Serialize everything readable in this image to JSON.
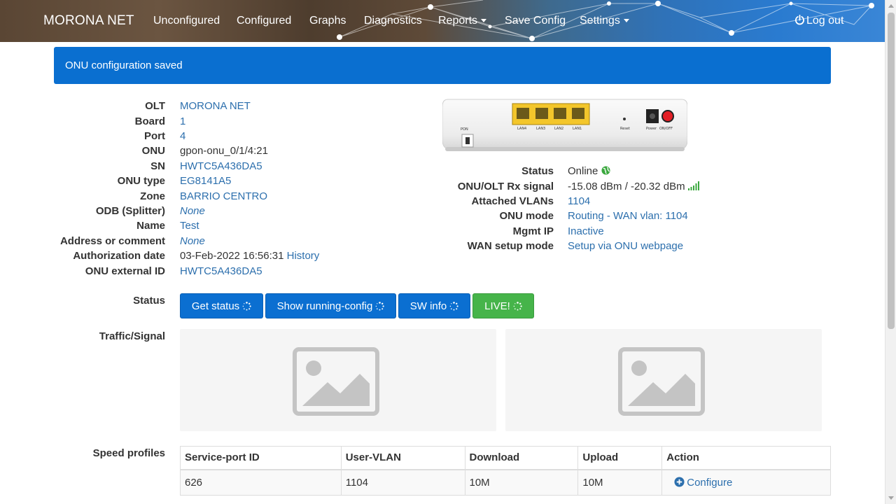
{
  "navbar": {
    "brand": "MORONA NET",
    "items": [
      {
        "label": "Unconfigured"
      },
      {
        "label": "Configured"
      },
      {
        "label": "Graphs"
      },
      {
        "label": "Diagnostics"
      },
      {
        "label": "Reports"
      },
      {
        "label": "Save Config"
      },
      {
        "label": "Settings"
      }
    ],
    "logout": "Log out"
  },
  "alert": {
    "message": "ONU configuration saved"
  },
  "details_left": [
    {
      "label": "OLT",
      "value": "MORONA NET"
    },
    {
      "label": "Board",
      "value": "1"
    },
    {
      "label": "Port",
      "value": "4"
    },
    {
      "label": "ONU",
      "value": "gpon-onu_0/1/4:21"
    },
    {
      "label": "SN",
      "value": "HWTC5A436DA5"
    },
    {
      "label": "ONU type",
      "value": "EG8141A5"
    },
    {
      "label": "Zone",
      "value": "BARRIO CENTRO"
    },
    {
      "label": "ODB (Splitter)",
      "value": "None"
    },
    {
      "label": "Name",
      "value": "Test"
    },
    {
      "label": "Address or comment",
      "value": "None"
    },
    {
      "label": "Authorization date",
      "value": "03-Feb-2022 16:56:31",
      "link": "History"
    },
    {
      "label": "ONU external ID",
      "value": "HWTC5A436DA5"
    }
  ],
  "device_image": {
    "ports": [
      "LAN4",
      "LAN3",
      "LAN2",
      "LAN1"
    ],
    "pon_label": "PON",
    "reset_label": "Reset",
    "power_label": "Power",
    "onoff_label": "ON/OFF"
  },
  "details_right": [
    {
      "label": "Status",
      "value": "Online"
    },
    {
      "label": "ONU/OLT Rx signal",
      "value": "-15.08 dBm / -20.32 dBm"
    },
    {
      "label": "Attached VLANs",
      "value": "1104"
    },
    {
      "label": "ONU mode",
      "value": "Routing - WAN vlan: 1104"
    },
    {
      "label": "Mgmt IP",
      "value": "Inactive"
    },
    {
      "label": "WAN setup mode",
      "value": "Setup via ONU webpage"
    }
  ],
  "status_section": {
    "label": "Status",
    "buttons": [
      {
        "label": "Get status"
      },
      {
        "label": "Show running-config"
      },
      {
        "label": "SW info"
      },
      {
        "label": "LIVE!"
      }
    ]
  },
  "traffic_section": {
    "label": "Traffic/Signal"
  },
  "speed_profiles": {
    "label": "Speed profiles",
    "columns": [
      "Service-port ID",
      "User-VLAN",
      "Download",
      "Upload",
      "Action"
    ],
    "rows": [
      {
        "service_port_id": "626",
        "user_vlan": "1104",
        "download": "10M",
        "upload": "10M",
        "action": "Configure"
      }
    ]
  },
  "colors": {
    "link": "#2c6fad",
    "primary_button": "#0b6fd1",
    "live_button": "#46b44a",
    "alert_bg": "#0a6fd0",
    "online_icon": "#3aa83e"
  }
}
